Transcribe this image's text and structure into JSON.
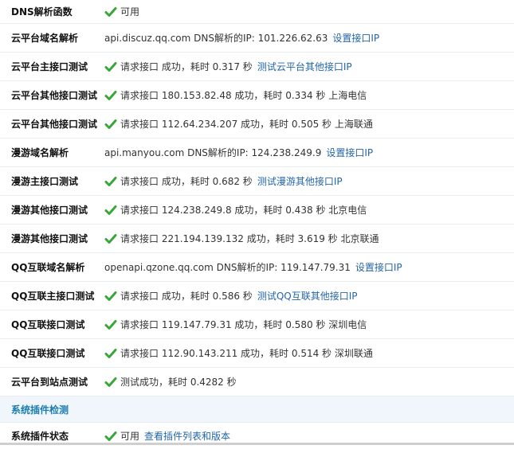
{
  "rows": [
    {
      "label": "DNS解析函数",
      "check": true,
      "text": "可用",
      "link": ""
    },
    {
      "label": "云平台域名解析",
      "check": false,
      "text": "api.discuz.qq.com DNS解析的IP: 101.226.62.63",
      "link": "设置接口IP"
    },
    {
      "label": "云平台主接口测试",
      "check": true,
      "text": "请求接口 成功，耗时 0.317 秒",
      "link": "测试云平台其他接口IP"
    },
    {
      "label": "云平台其他接口测试",
      "check": true,
      "text": "请求接口 180.153.82.48 成功，耗时 0.334 秒 上海电信",
      "link": ""
    },
    {
      "label": "云平台其他接口测试",
      "check": true,
      "text": "请求接口 112.64.234.207 成功，耗时 0.505 秒 上海联通",
      "link": ""
    },
    {
      "label": "漫游域名解析",
      "check": false,
      "text": "api.manyou.com DNS解析的IP: 124.238.249.9",
      "link": "设置接口IP"
    },
    {
      "label": "漫游主接口测试",
      "check": true,
      "text": "请求接口 成功，耗时 0.682 秒",
      "link": "测试漫游其他接口IP"
    },
    {
      "label": "漫游其他接口测试",
      "check": true,
      "text": "请求接口 124.238.249.8 成功，耗时 0.438 秒 北京电信",
      "link": ""
    },
    {
      "label": "漫游其他接口测试",
      "check": true,
      "text": "请求接口 221.194.139.132 成功，耗时 3.619 秒 北京联通",
      "link": ""
    },
    {
      "label": "QQ互联域名解析",
      "check": false,
      "text": "openapi.qzone.qq.com DNS解析的IP: 119.147.79.31",
      "link": "设置接口IP"
    },
    {
      "label": "QQ互联主接口测试",
      "check": true,
      "text": "请求接口 成功，耗时 0.586 秒",
      "link": "测试QQ互联其他接口IP"
    },
    {
      "label": "QQ互联接口测试",
      "check": true,
      "text": "请求接口 119.147.79.31 成功，耗时 0.580 秒 深圳电信",
      "link": ""
    },
    {
      "label": "QQ互联接口测试",
      "check": true,
      "text": "请求接口 112.90.143.211 成功，耗时 0.514 秒 深圳联通",
      "link": ""
    },
    {
      "label": "云平台到站点测试",
      "check": true,
      "text": "测试成功，耗时 0.4282 秒",
      "link": ""
    }
  ],
  "section_title": "系统插件检测",
  "plugin_row": {
    "label": "系统插件状态",
    "text": "可用",
    "link": "查看插件列表和版本"
  },
  "colors": {
    "check": "#3aa63a",
    "link": "#2366a8",
    "section_text": "#1a7cb0",
    "section_bg": "#f0f6fb"
  },
  "icons": {
    "check": "check-icon"
  }
}
